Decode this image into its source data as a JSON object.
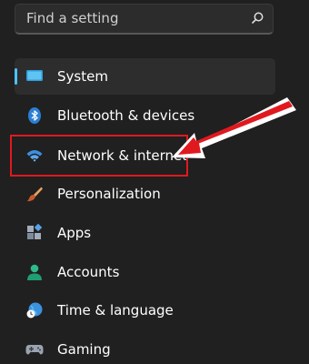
{
  "search": {
    "placeholder": "Find a setting",
    "icon": "search-icon"
  },
  "sidebar": {
    "items": [
      {
        "label": "System",
        "icon": "system-monitor-icon",
        "selected": true
      },
      {
        "label": "Bluetooth & devices",
        "icon": "bluetooth-icon"
      },
      {
        "label": "Network & internet",
        "icon": "wifi-icon"
      },
      {
        "label": "Personalization",
        "icon": "brush-icon"
      },
      {
        "label": "Apps",
        "icon": "apps-icon"
      },
      {
        "label": "Accounts",
        "icon": "person-icon"
      },
      {
        "label": "Time & language",
        "icon": "globe-clock-icon"
      },
      {
        "label": "Gaming",
        "icon": "gamepad-icon"
      }
    ]
  },
  "annotation": {
    "highlighted_item": "Network & internet",
    "highlight_color": "#e0191f",
    "arrow_color": "#e0191f"
  },
  "colors": {
    "background": "#202020",
    "accent": "#4cc2ff",
    "selected_bg": "#2d2d2d"
  }
}
